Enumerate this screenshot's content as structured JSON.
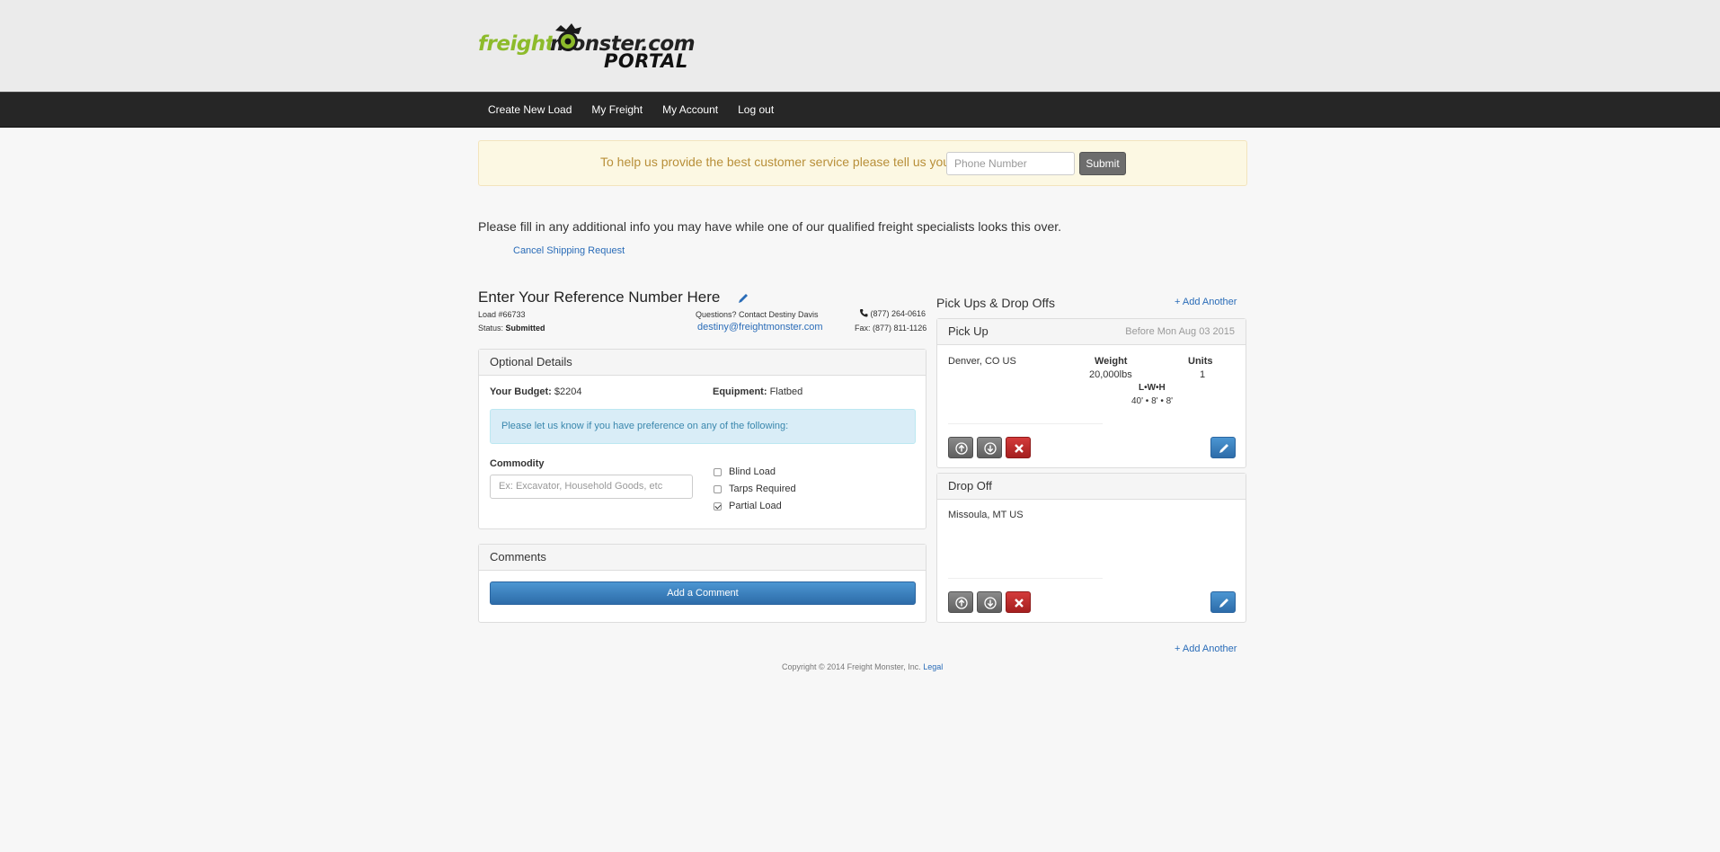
{
  "logo": {
    "word1": "freight",
    "word2": "monster.com",
    "sub": "PORTAL"
  },
  "nav": {
    "items": [
      "Create New Load",
      "My Freight",
      "My Account",
      "Log out"
    ]
  },
  "banner": {
    "text": "To help us provide the best customer service please tell us your",
    "phone_placeholder": "Phone Number",
    "submit": "Submit"
  },
  "intro": "Please fill in any additional info you may have while one of our qualified freight specialists looks this over.",
  "cancel": "Cancel Shipping Request",
  "reference": {
    "title": "Enter Your Reference Number Here",
    "load": "Load #66733",
    "status_label": "Status:",
    "status_value": "Submitted",
    "contact": "Questions? Contact Destiny Davis",
    "email": "destiny@freightmonster.com",
    "phone": "(877) 264-0616",
    "fax": "Fax: (877) 811-1126"
  },
  "optional": {
    "heading": "Optional Details",
    "budget_label": "Your Budget:",
    "budget_value": "$2204",
    "equipment_label": "Equipment:",
    "equipment_value": "Flatbed",
    "info": "Please let us know if you have preference on any of the following:",
    "commodity_label": "Commodity",
    "commodity_placeholder": "Ex: Excavator, Household Goods, etc",
    "options": [
      {
        "label": "Blind Load",
        "checked": false
      },
      {
        "label": "Tarps Required",
        "checked": false
      },
      {
        "label": "Partial Load",
        "checked": true
      }
    ]
  },
  "comments": {
    "heading": "Comments",
    "button": "Add a Comment"
  },
  "stops": {
    "heading": "Pick Ups & Drop Offs",
    "add_another": "+ Add Another",
    "pickup": {
      "title": "Pick Up",
      "date": "Before Mon Aug 03 2015",
      "location": "Denver, CO US",
      "weight_label": "Weight",
      "weight_value": "20,000lbs",
      "units_label": "Units",
      "units_value": "1",
      "lwh_label": "L•W•H",
      "lwh_value": "40' • 8' • 8'"
    },
    "dropoff": {
      "title": "Drop Off",
      "location": "Missoula, MT US"
    }
  },
  "footer": {
    "copyright": "Copyright © 2014 Freight Monster, Inc.",
    "legal": "Legal"
  },
  "colors": {
    "nav_bg": "#262626",
    "link": "#2a6cb8",
    "banner_bg": "#fcf8e3",
    "brand_green": "#8dbb2b"
  }
}
